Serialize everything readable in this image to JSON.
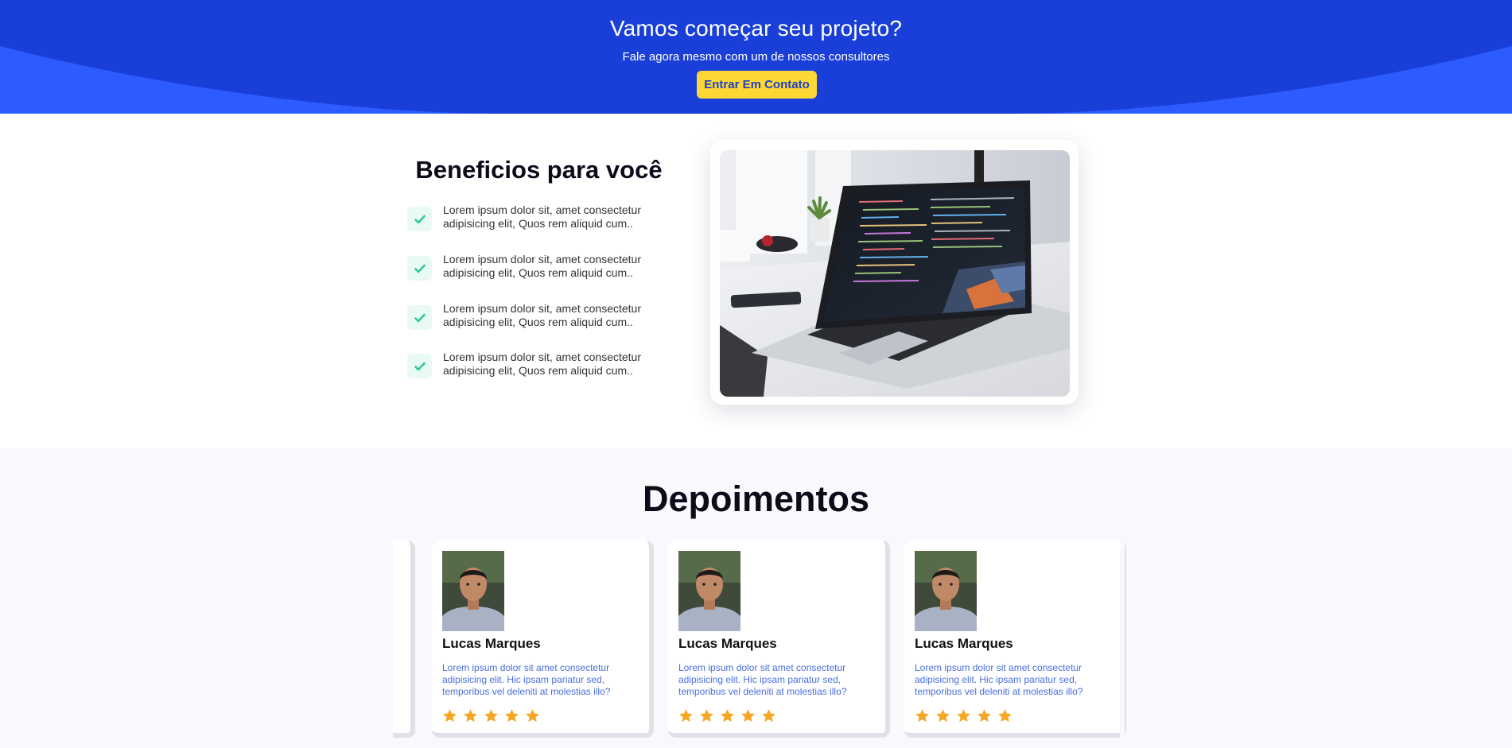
{
  "cta": {
    "title": "Vamos começar seu projeto?",
    "subtitle": "Fale agora mesmo com um de nossos consultores",
    "button_label": "Entrar Em Contato",
    "colors": {
      "background": "#2c5cff",
      "curve": "#1a3fd9",
      "button": "#fdd835",
      "button_text": "#1e3fc6"
    }
  },
  "benefits": {
    "title": "Beneficios para você",
    "items": [
      {
        "icon": "check-icon",
        "line1": "Lorem ipsum dolor sit, amet consectetur",
        "line2": "adipisicing elit, Quos rem aliquid cum.."
      },
      {
        "icon": "check-icon",
        "line1": "Lorem ipsum dolor sit, amet consectetur",
        "line2": "adipisicing elit, Quos rem aliquid cum.."
      },
      {
        "icon": "check-icon",
        "line1": "Lorem ipsum dolor sit, amet consectetur",
        "line2": "adipisicing elit, Quos rem aliquid cum.."
      },
      {
        "icon": "check-icon",
        "line1": "Lorem ipsum dolor sit, amet consectetur",
        "line2": "adipisicing elit, Quos rem aliquid cum.."
      }
    ],
    "image": "laptop-with-code-photo",
    "check_color": "#2ecc8f"
  },
  "testimonials": {
    "title": "Depoimentos",
    "cards": [
      {
        "avatar": "person-photo",
        "name": "Lucas Marques",
        "text": "Lorem ipsum dolor sit amet consectetur adipisicing elit. Hic ipsam pariatur sed, temporibus vel deleniti at molestias illo?",
        "rating": 5
      },
      {
        "avatar": "person-photo",
        "name": "Lucas Marques",
        "text": "Lorem ipsum dolor sit amet consectetur adipisicing elit. Hic ipsam pariatur sed, temporibus vel deleniti at molestias illo?",
        "rating": 5
      },
      {
        "avatar": "person-photo",
        "name": "Lucas Marques",
        "text": "Lorem ipsum dolor sit amet consectetur adipisicing elit. Hic ipsam pariatur sed, temporibus vel deleniti at molestias illo?",
        "rating": 5
      }
    ],
    "star_color": "#f5a623",
    "text_color": "#4a6fe0"
  }
}
